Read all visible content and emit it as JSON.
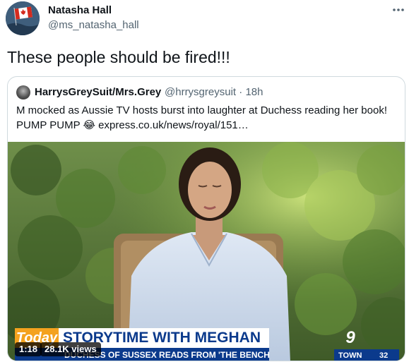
{
  "author": {
    "name": "Natasha Hall",
    "handle": "@ms_natasha_hall",
    "avatar_icon": "canada-flag-avatar"
  },
  "tweet_text": "These people should be fired!!!",
  "quoted": {
    "name": "HarrysGreySuit/Mrs.Grey",
    "handle": "@hrrysgreysuit",
    "separator": "·",
    "time": "18h",
    "text_line1": "M mocked as Aussie TV hosts burst into laughter at Duchess reading her book!",
    "text_line2_prefix": "PUMP PUMP ",
    "emoji": "😂",
    "link": "express.co.uk/news/royal/151…"
  },
  "video": {
    "banner_brand": "Today",
    "banner_title": "STORYTIME WITH MEGHAN",
    "banner_subtitle": "DUCHESS OF SUSSEX READS FROM 'THE BENCH'",
    "channel_logo": "9",
    "town_label": "TOWN",
    "temp_label": "32",
    "duration": "1:18",
    "views": "28.1K views"
  },
  "colors": {
    "text_primary": "#0f1419",
    "text_secondary": "#536471",
    "border": "#cfd9de",
    "banner_blue": "#0b3a8c",
    "today_orange": "#f4a21e"
  }
}
